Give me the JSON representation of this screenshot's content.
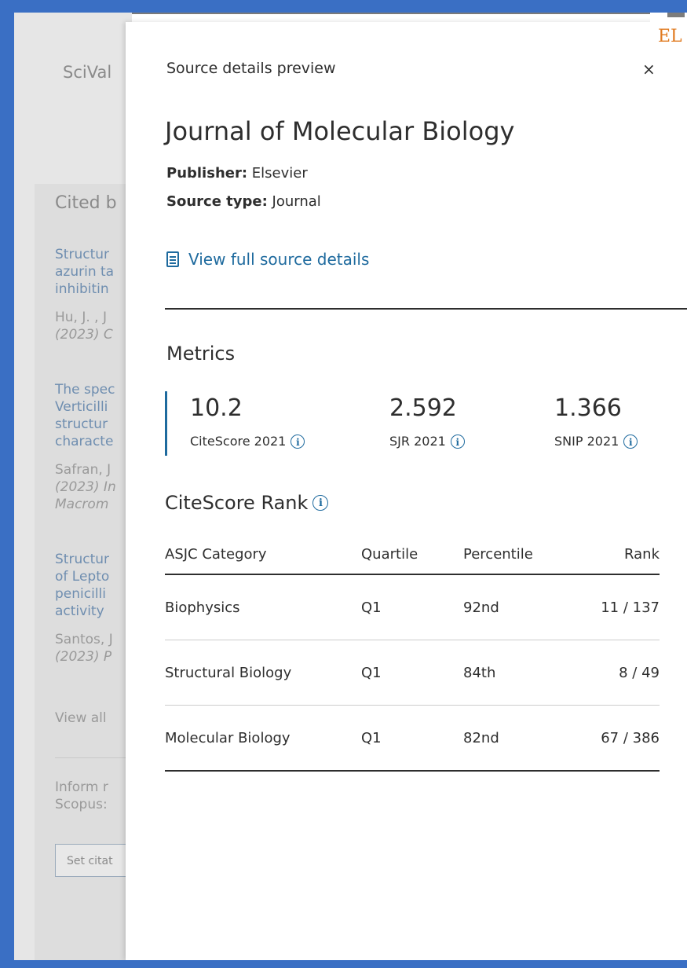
{
  "background": {
    "brand": "SciVal",
    "cited_by": "Cited b",
    "items": [
      {
        "title_lines": [
          "Structur",
          "azurin ta",
          "inhibitin"
        ],
        "authors": "Hu, J. , J",
        "year": "(2023) C"
      },
      {
        "title_lines": [
          "The spec",
          "Verticilli",
          "structur",
          "characte"
        ],
        "authors": "Safran, J",
        "year_lines": [
          "(2023) In",
          "Macrom"
        ]
      },
      {
        "title_lines": [
          "Structur",
          "of Lepto",
          "penicilli",
          "activity"
        ],
        "authors": "Santos, J",
        "year": "(2023) P"
      }
    ],
    "view_all": "View all",
    "inform_lines": [
      "Inform r",
      "Scopus:"
    ],
    "set_citation_button": "Set citat"
  },
  "logo": {
    "text": "EL",
    "color": "#e07a1f"
  },
  "panel": {
    "preview_label": "Source details preview",
    "close_icon": "×",
    "journal_title": "Journal of Molecular Biology",
    "publisher_label": "Publisher:",
    "publisher_value": "Elsevier",
    "source_type_label": "Source type:",
    "source_type_value": "Journal",
    "view_full_link": "View full source details",
    "metrics_title": "Metrics",
    "metrics": [
      {
        "value": "10.2",
        "label": "CiteScore 2021"
      },
      {
        "value": "2.592",
        "label": "SJR 2021"
      },
      {
        "value": "1.366",
        "label": "SNIP 2021"
      }
    ],
    "info_glyph": "i",
    "rank_title": "CiteScore Rank",
    "rank_table": {
      "headers": [
        "ASJC Category",
        "Quartile",
        "Percentile",
        "Rank"
      ],
      "rows": [
        [
          "Biophysics",
          "Q1",
          "92nd",
          "11 / 137"
        ],
        [
          "Structural Biology",
          "Q1",
          "84th",
          "8 / 49"
        ],
        [
          "Molecular Biology",
          "Q1",
          "82nd",
          "67 / 386"
        ]
      ]
    }
  },
  "colors": {
    "accent": "#1e6a9e",
    "frame": "#3a6fc4",
    "text": "#2e2e2e"
  }
}
